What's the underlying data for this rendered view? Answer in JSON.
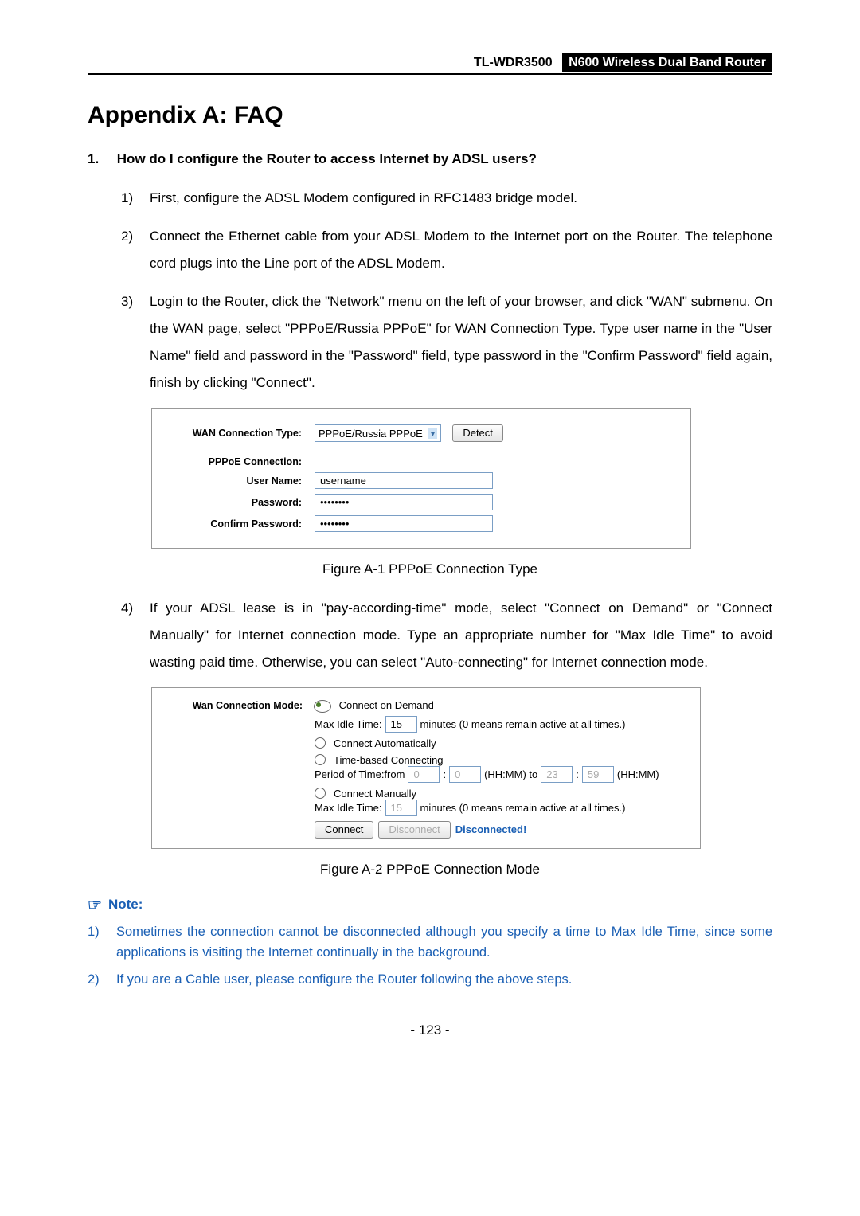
{
  "header": {
    "model": "TL-WDR3500",
    "product": "N600 Wireless Dual Band Router"
  },
  "title": "Appendix A: FAQ",
  "question1": {
    "num": "1.",
    "text": "How do I configure the Router to access Internet by ADSL users?"
  },
  "steps": {
    "s1": {
      "num": "1)",
      "text": "First, configure the ADSL Modem configured in RFC1483 bridge model."
    },
    "s2": {
      "num": "2)",
      "text": "Connect the Ethernet cable from your ADSL Modem to the Internet port on the Router. The telephone cord plugs into the Line port of the ADSL Modem."
    },
    "s3": {
      "num": "3)",
      "text": "Login to the Router, click the \"Network\" menu on the left of your browser, and click \"WAN\" submenu. On the WAN page, select \"PPPoE/Russia PPPoE\" for WAN Connection Type. Type user name in the \"User Name\" field and password in the \"Password\" field, type password in the \"Confirm Password\" field again, finish by clicking \"Connect\"."
    },
    "s4": {
      "num": "4)",
      "text": "If your ADSL lease is in \"pay-according-time\" mode, select \"Connect on Demand\" or \"Connect Manually\" for Internet connection mode. Type an appropriate number for \"Max Idle Time\" to avoid wasting paid time. Otherwise, you can select \"Auto-connecting\" for Internet connection mode."
    }
  },
  "figA1": {
    "wan_conn_type_label": "WAN Connection Type:",
    "wan_conn_type_value": "PPPoE/Russia PPPoE",
    "detect": "Detect",
    "pppoe_conn_label": "PPPoE Connection:",
    "user_name_label": "User Name:",
    "user_name_value": "username",
    "password_label": "Password:",
    "password_value": "••••••••",
    "confirm_label": "Confirm Password:",
    "confirm_value": "••••••••",
    "caption": "Figure A-1 PPPoE Connection Type"
  },
  "figA2": {
    "mode_label": "Wan Connection Mode:",
    "opt_demand": "Connect on Demand",
    "max_idle_label": "Max Idle Time:",
    "max_idle_val1": "15",
    "max_idle_suffix": "minutes (0 means remain active at all times.)",
    "opt_auto": "Connect Automatically",
    "opt_time": "Time-based Connecting",
    "period_label": "Period of Time:from",
    "t_from_h": "0",
    "t_from_m": "0",
    "hhmm_to": "(HH:MM) to",
    "t_to_h": "23",
    "t_to_m": "59",
    "hhmm": "(HH:MM)",
    "opt_manual": "Connect Manually",
    "max_idle_val2": "15",
    "connect": "Connect",
    "disconnect": "Disconnect",
    "status": "Disconnected!",
    "caption": "Figure A-2 PPPoE Connection Mode"
  },
  "note": {
    "head": "Note:",
    "n1num": "1)",
    "n1": "Sometimes the connection cannot be disconnected although you specify a time to Max Idle Time, since some applications is visiting the Internet continually in the background.",
    "n2num": "2)",
    "n2": "If you are a Cable user, please configure the Router following the above steps."
  },
  "pagefoot": "- 123 -"
}
